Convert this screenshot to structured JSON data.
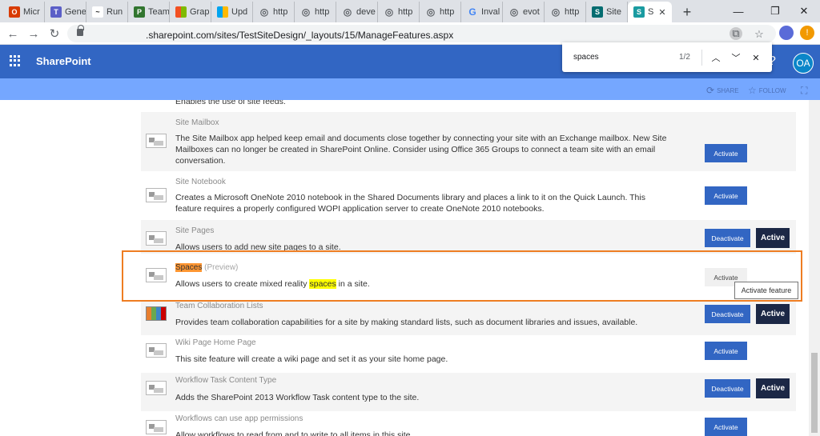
{
  "browser": {
    "tabs": [
      {
        "label": "Micr",
        "icon": "office-icon",
        "color": "#d83b01",
        "glyph": "O"
      },
      {
        "label": "Gene",
        "icon": "teams-icon",
        "color": "#5b5fc7",
        "glyph": "T"
      },
      {
        "label": "Run",
        "icon": "flow-icon",
        "color": "#222222",
        "glyph": "~"
      },
      {
        "label": "Team",
        "icon": "planner-icon",
        "color": "#31752f",
        "glyph": "P"
      },
      {
        "label": "Grap",
        "icon": "microsoft-icon",
        "color": "#f25022",
        "glyph": "■"
      },
      {
        "label": "Upd",
        "icon": "microsoft-icon",
        "color": "#f25022",
        "glyph": "■"
      },
      {
        "label": "http",
        "icon": "globe-icon",
        "color": "#5f6368",
        "glyph": "◎"
      },
      {
        "label": "http",
        "icon": "globe-icon",
        "color": "#5f6368",
        "glyph": "◎"
      },
      {
        "label": "deve",
        "icon": "globe-icon",
        "color": "#5f6368",
        "glyph": "◎"
      },
      {
        "label": "http",
        "icon": "globe-icon",
        "color": "#5f6368",
        "glyph": "◎"
      },
      {
        "label": "http",
        "icon": "globe-icon",
        "color": "#5f6368",
        "glyph": "◎"
      },
      {
        "label": "Inval",
        "icon": "google-icon",
        "color": "#4285f4",
        "glyph": "G"
      },
      {
        "label": "evot",
        "icon": "globe-icon",
        "color": "#5f6368",
        "glyph": "◎"
      },
      {
        "label": "http",
        "icon": "globe-icon",
        "color": "#5f6368",
        "glyph": "◎"
      },
      {
        "label": "Site",
        "icon": "sharepoint-icon",
        "color": "#036c70",
        "glyph": "S"
      }
    ],
    "active_tab": {
      "label": "S",
      "icon": "sharepoint-icon",
      "color": "#1a9ba1",
      "glyph": "S"
    },
    "url": ".sharepoint.com/sites/TestSiteDesign/_layouts/15/ManageFeatures.aspx"
  },
  "suite": {
    "brand": "SharePoint",
    "avatar_initials": "OA",
    "bar_color": "#3266c3"
  },
  "find": {
    "query": "spaces",
    "count": "1/2"
  },
  "site_actions": {
    "share": "SHARE",
    "follow": "FOLLOW"
  },
  "features": [
    {
      "title": "",
      "desc": "Enables the use of site feeds."
    },
    {
      "title": "Site Mailbox",
      "desc": "The Site Mailbox app helped keep email and documents close together by connecting your site with an Exchange mailbox. New Site Mailboxes can no longer be created in SharePoint Online. Consider using Office 365 Groups to connect a team site with an email conversation.",
      "button": "Activate"
    },
    {
      "title": "Site Notebook",
      "desc": "Creates a Microsoft OneNote 2010 notebook in the Shared Documents library and places a link to it on the Quick Launch. This feature requires a properly configured WOPI application server to create OneNote 2010 notebooks.",
      "button": "Activate"
    },
    {
      "title": "Site Pages",
      "desc": "Allows users to add new site pages to a site.",
      "button": "Deactivate",
      "status": "Active"
    },
    {
      "title": "Spaces",
      "title_suffix": "(Preview)",
      "desc_pre": "Allows users to create mixed reality ",
      "desc_match": "spaces",
      "desc_post": " in a site.",
      "button": "Activate",
      "tooltip": "Activate feature"
    },
    {
      "title": "Team Collaboration Lists",
      "desc": "Provides team collaboration capabilities for a site by making standard lists, such as document libraries and issues, available.",
      "button": "Deactivate",
      "status": "Active"
    },
    {
      "title": "Wiki Page Home Page",
      "desc": "This site feature will create a wiki page and set it as your site home page.",
      "button": "Activate"
    },
    {
      "title": "Workflow Task Content Type",
      "desc": "Adds the SharePoint 2013 Workflow Task content type to the site.",
      "button": "Deactivate",
      "status": "Active"
    },
    {
      "title": "Workflows can use app permissions",
      "desc": "Allow workflows to read from and to write to all items in this site.",
      "button": "Activate"
    }
  ]
}
